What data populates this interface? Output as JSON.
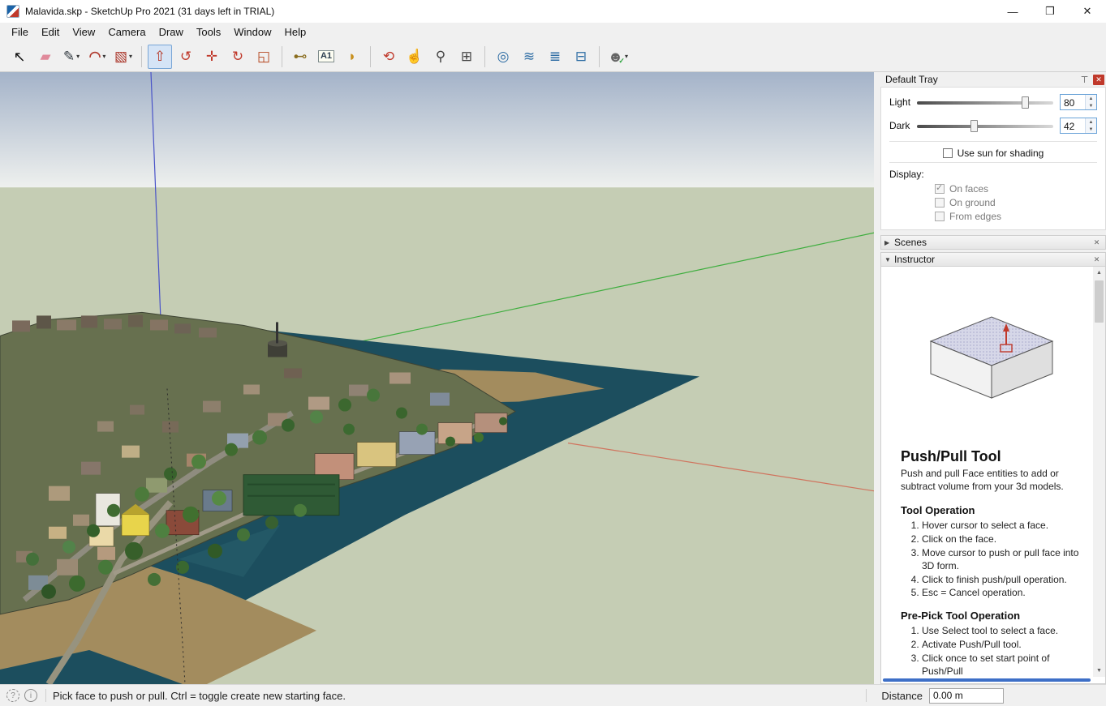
{
  "window": {
    "title": "Malavida.skp - SketchUp Pro 2021 (31 days left in TRIAL)",
    "minimize_glyph": "—",
    "maximize_glyph": "❒",
    "close_glyph": "✕"
  },
  "menu": {
    "items": [
      "File",
      "Edit",
      "View",
      "Camera",
      "Draw",
      "Tools",
      "Window",
      "Help"
    ]
  },
  "toolbar": {
    "tools": [
      {
        "name": "select-tool",
        "glyph": "↖"
      },
      {
        "name": "eraser-tool",
        "glyph": "▰"
      },
      {
        "name": "line-tool",
        "glyph": "✎",
        "dropdown": true
      },
      {
        "name": "arc-tool",
        "glyph": "◠",
        "dropdown": true
      },
      {
        "name": "shapes-tool",
        "glyph": "▧",
        "dropdown": true
      },
      {
        "sep": true
      },
      {
        "name": "push-pull-tool",
        "glyph": "⇧",
        "active": true
      },
      {
        "name": "offset-tool",
        "glyph": "↺"
      },
      {
        "name": "move-tool",
        "glyph": "✛"
      },
      {
        "name": "rotate-tool",
        "glyph": "↻"
      },
      {
        "name": "scale-tool",
        "glyph": "◱"
      },
      {
        "sep": true
      },
      {
        "name": "tape-measure-tool",
        "glyph": "⊷"
      },
      {
        "name": "text-tool",
        "glyph": "A1"
      },
      {
        "name": "paint-bucket-tool",
        "glyph": "◗"
      },
      {
        "sep": true
      },
      {
        "name": "orbit-tool",
        "glyph": "⟲"
      },
      {
        "name": "pan-tool",
        "glyph": "☝"
      },
      {
        "name": "zoom-tool",
        "glyph": "⚲"
      },
      {
        "name": "zoom-extents-tool",
        "glyph": "⊞"
      },
      {
        "sep": true
      },
      {
        "name": "styles-view-tool",
        "glyph": "◎"
      },
      {
        "name": "xray-view-tool",
        "glyph": "≋"
      },
      {
        "name": "layers-view-tool",
        "glyph": "≣"
      },
      {
        "name": "section-view-tool",
        "glyph": "⊟"
      },
      {
        "sep": true
      },
      {
        "name": "account-avatar",
        "glyph": "☻",
        "badge": "✓",
        "dropdown": true
      }
    ]
  },
  "tray": {
    "title": "Default Tray",
    "pin_glyph": "⊤",
    "close_glyph": "✕",
    "spin_up_glyph": "▲",
    "spin_down_glyph": "▼",
    "scroll_up_glyph": "▲",
    "scroll_down_glyph": "▼",
    "shadow": {
      "light_label": "Light",
      "light_value": "80",
      "dark_label": "Dark",
      "dark_value": "42",
      "use_sun_label": "Use sun for shading",
      "use_sun_checked": false,
      "display_label": "Display:",
      "on_faces_label": "On faces",
      "on_faces_checked": true,
      "on_ground_label": "On ground",
      "on_ground_checked": false,
      "from_edges_label": "From edges",
      "from_edges_checked": false
    },
    "scenes": {
      "label": "Scenes",
      "arrow": "▶",
      "close_glyph": "✕"
    },
    "instructor": {
      "label": "Instructor",
      "arrow": "▼",
      "close_glyph": "✕",
      "title": "Push/Pull Tool",
      "description": "Push and pull Face entities to add or subtract volume from your 3d models.",
      "tool_operation_title": "Tool Operation",
      "tool_operation_steps": [
        "Hover cursor to select a face.",
        "Click on the face.",
        "Move cursor to push or pull face into 3D form.",
        "Click to finish push/pull operation.",
        "Esc = Cancel operation."
      ],
      "prepick_title": "Pre-Pick Tool Operation",
      "prepick_steps": [
        "Use Select tool to select a face.",
        "Activate Push/Pull tool.",
        "Click once to set start point of Push/Pull"
      ]
    }
  },
  "statusbar": {
    "help_glyph": "?",
    "info_glyph": "i",
    "hint": "Pick face to push or pull.  Ctrl = toggle create new starting face.",
    "distance_label": "Distance",
    "distance_value": "0.00 m"
  },
  "colors": {
    "sky_top": "#a4b3c9",
    "ground": "#c5cdb4",
    "water": "#1c4e5e",
    "sand": "#a38c5e",
    "axis_green": "#3fae3f",
    "axis_red": "#d0745e",
    "axis_blue": "#4953c8",
    "active_tool_highlight": "#d5e4f6"
  }
}
